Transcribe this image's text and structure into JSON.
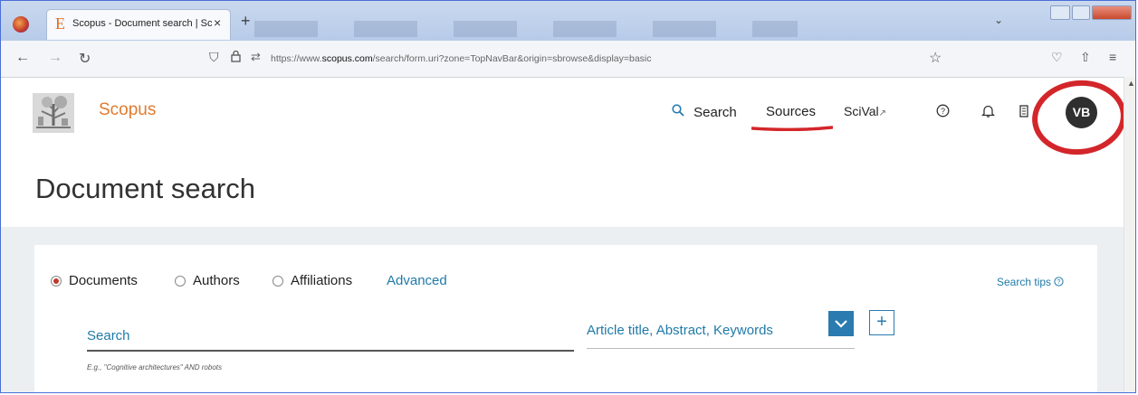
{
  "browser": {
    "tab": {
      "title": "Scopus - Document search | Sc",
      "close": "×",
      "favicon": "E"
    },
    "new_tab": "+",
    "list_tabs": "⌄",
    "url": {
      "scheme": "https://www.",
      "host": "scopus.com",
      "path": "/search/form.uri?zone=TopNavBar&origin=sbrowse&display=basic"
    }
  },
  "header": {
    "brand": "Scopus",
    "nav": {
      "search": "Search",
      "sources": "Sources",
      "scival": "SciVal",
      "scival_suffix": "↗"
    },
    "avatar_initials": "VB"
  },
  "page": {
    "title": "Document search",
    "search_type": {
      "options": [
        "Documents",
        "Authors",
        "Affiliations"
      ],
      "selected": "Documents",
      "advanced": "Advanced"
    },
    "search_tips": "Search tips",
    "search": {
      "placeholder": "Search",
      "field": "Article title, Abstract, Keywords",
      "add_label": "+",
      "hint": "E.g., \"Cognitive architectures\" AND robots"
    }
  },
  "colors": {
    "accent": "#2a7bb0",
    "brand": "#e07b2e",
    "annotation": "#d3262a"
  }
}
